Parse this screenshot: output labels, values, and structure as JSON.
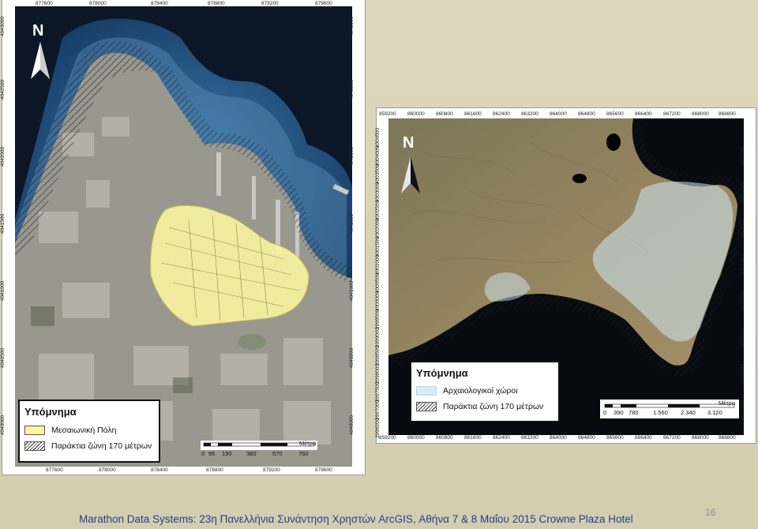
{
  "map_left": {
    "x_ticks": [
      "877600",
      "878000",
      "878400",
      "878800",
      "879200",
      "879600"
    ],
    "y_ticks": [
      "4043000",
      "4042500",
      "4042000",
      "4041500",
      "4041000",
      "4040500",
      "4040000"
    ],
    "north_label": "N",
    "legend": {
      "title": "Υπόμνημα",
      "items": [
        {
          "label": "Μεσαιωνική Πόλη",
          "swatch": "yellow"
        },
        {
          "label": "Παράκτια ζώνη 170 μέτρων",
          "swatch": "hatch"
        }
      ]
    },
    "scale": {
      "unit": "Μέτρα",
      "ticks": [
        "0",
        "95",
        "190",
        "380",
        "570",
        "760"
      ]
    },
    "colors": {
      "old_town": "#fbf5a0",
      "sea": "#1f4f86"
    }
  },
  "map_right": {
    "x_ticks": [
      "859200",
      "860000",
      "860800",
      "861600",
      "862400",
      "863200",
      "864000",
      "864800",
      "865600",
      "866400",
      "867200",
      "868000",
      "868800"
    ],
    "y_ticks": [
      "4004500",
      "4004000",
      "4003500",
      "4003000",
      "4002500",
      "4002000",
      "4001500",
      "4001000",
      "4000500",
      "4000000",
      "3999500",
      "3999000",
      "3998500",
      "3998000",
      "3997500",
      "3997000",
      "3996500"
    ],
    "north_label": "N",
    "legend": {
      "title": "Υπόμνημα",
      "items": [
        {
          "label": "Αρχαιολογικοί χώροι",
          "swatch": "blue"
        },
        {
          "label": "Παράκτια ζώνη 170 μέτρων",
          "swatch": "hatch"
        }
      ]
    },
    "scale": {
      "unit": "Μέτρα",
      "ticks": [
        "0",
        "390",
        "780",
        "1.560",
        "2.340",
        "3.120"
      ]
    },
    "colors": {
      "archaeological": "#d3ecf6",
      "land": "#9c8a62"
    }
  },
  "footer": {
    "text": "Marathon Data Systems: 23η Πανελλήνια Συνάντηση Χρηστών ArcGIS, Αθήνα 7 & 8 Μαΐου 2015 Crowne Plaza Hotel",
    "page_number": "16"
  }
}
